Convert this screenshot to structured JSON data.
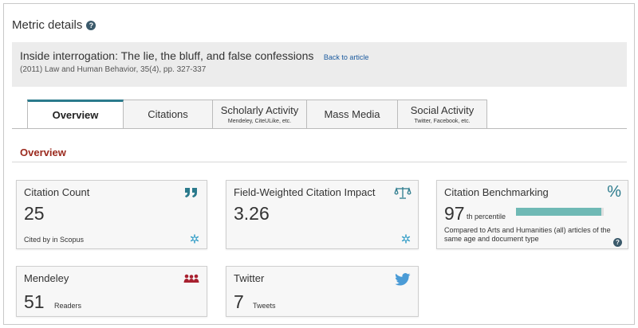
{
  "page": {
    "title": "Metric details",
    "help_icon": "question-circle-icon"
  },
  "article": {
    "title": "Inside interrogation: The lie, the bluff, and false confessions",
    "back_link": "Back to article",
    "meta": "(2011) Law and Human Behavior, 35(4), pp. 327-337"
  },
  "tabs": [
    {
      "label": "Overview",
      "sub": "",
      "active": true
    },
    {
      "label": "Citations",
      "sub": ""
    },
    {
      "label": "Scholarly Activity",
      "sub": "Mendeley, CiteULike, etc."
    },
    {
      "label": "Mass Media",
      "sub": ""
    },
    {
      "label": "Social Activity",
      "sub": "Twitter, Facebook, etc."
    }
  ],
  "section": {
    "title": "Overview"
  },
  "cards": {
    "citation_count": {
      "label": "Citation Count",
      "value": "25",
      "note": "Cited by in Scopus",
      "icon": "quote-icon",
      "icon_color": "#2b7a8c"
    },
    "fwci": {
      "label": "Field-Weighted Citation Impact",
      "value": "3.26",
      "icon": "balance-scale-icon",
      "icon_color": "#2b7a8c"
    },
    "benchmarking": {
      "label": "Citation Benchmarking",
      "value": "97",
      "value_suffix": "th percentile",
      "percentile": 97,
      "note": "Compared to Arts and Humanities (all) articles of the same age and document type",
      "icon": "percent-icon",
      "icon_color": "#2b7a8c"
    },
    "mendeley": {
      "label": "Mendeley",
      "value": "51",
      "unit": "Readers",
      "icon": "mendeley-icon",
      "icon_color": "#a8202f"
    },
    "twitter": {
      "label": "Twitter",
      "value": "7",
      "unit": "Tweets",
      "icon": "twitter-bird-icon",
      "icon_color": "#4a9bd6"
    }
  },
  "colors": {
    "accent": "#2b7a8c",
    "section_title": "#9b2a1e",
    "bar_fill": "#6fb9b5",
    "link": "#1a5a9e"
  }
}
